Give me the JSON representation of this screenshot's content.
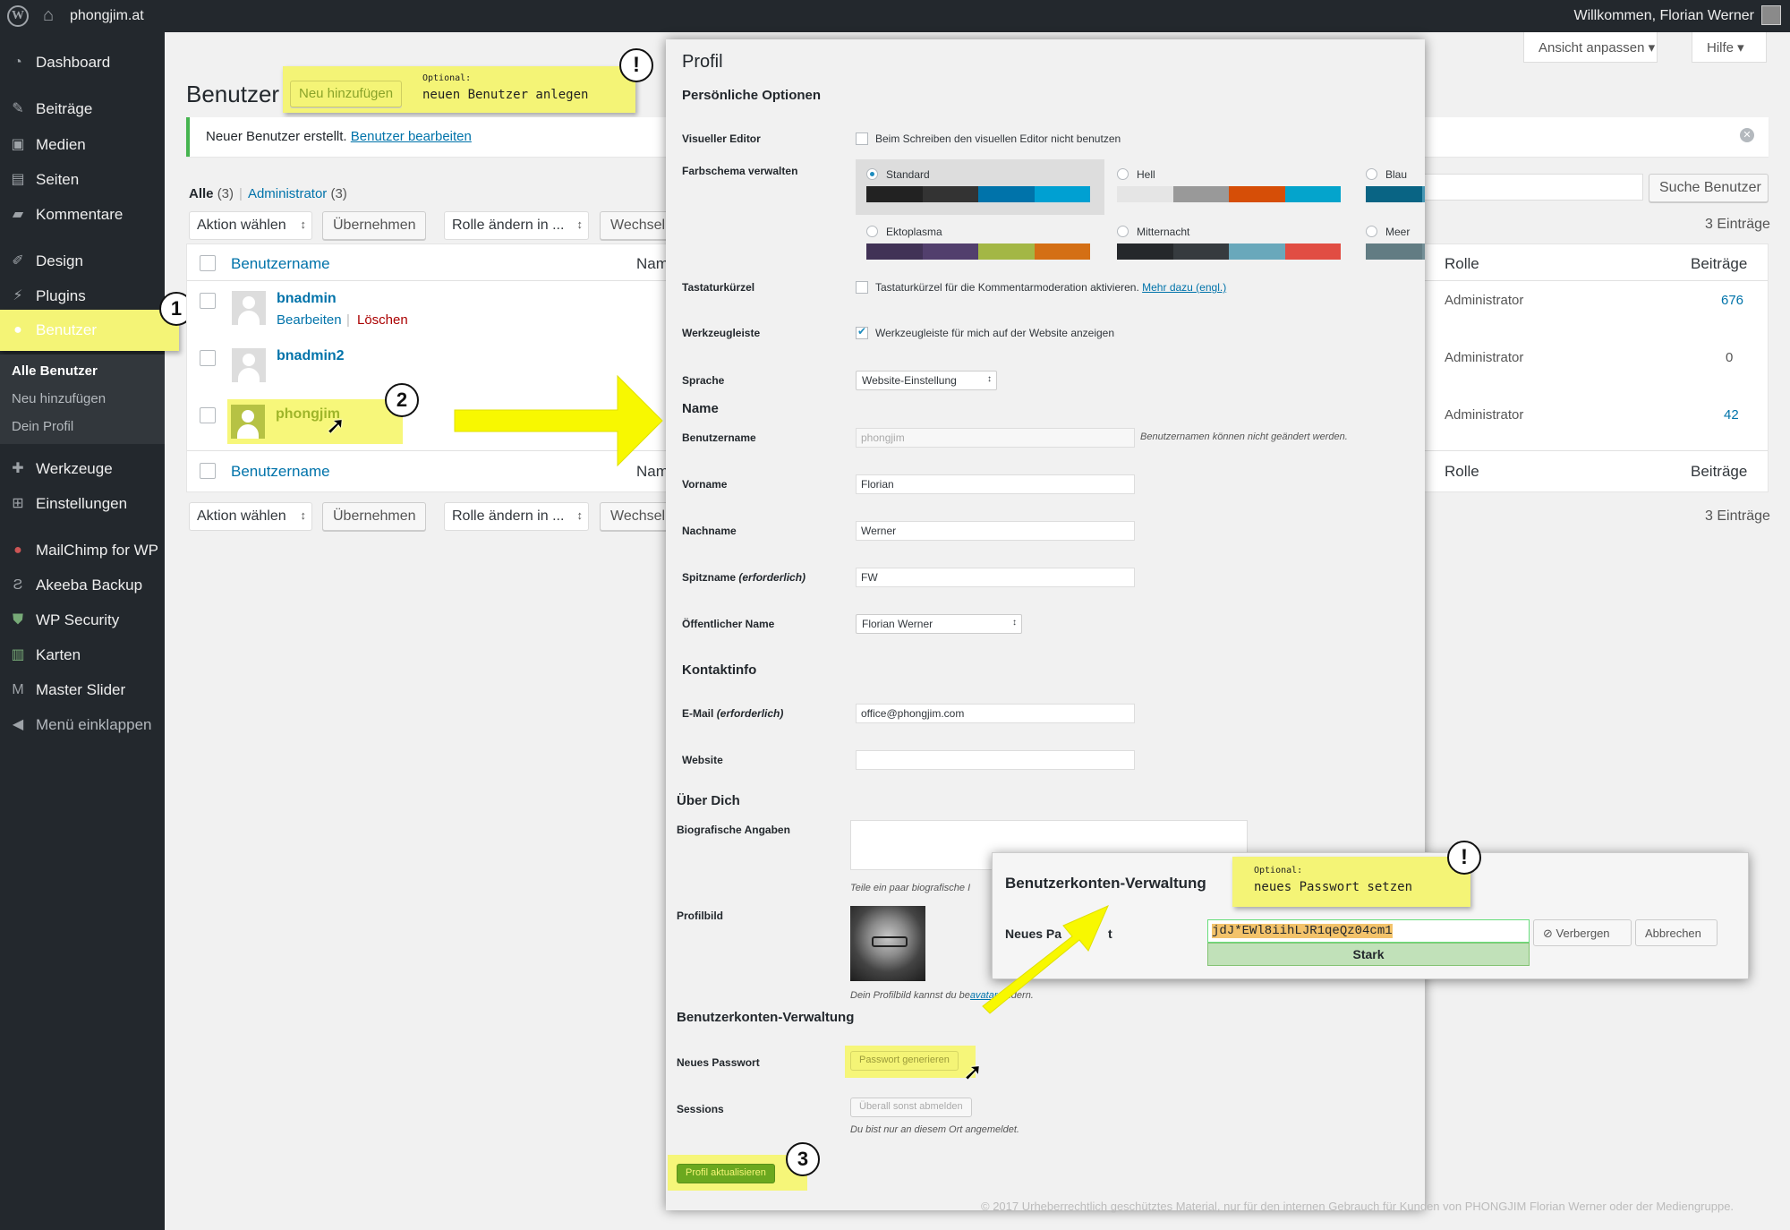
{
  "adminbar": {
    "site_name": "phongjim.at",
    "welcome": "Willkommen, Florian Werner"
  },
  "sidebar": {
    "items": [
      {
        "label": "Dashboard",
        "icon": "dashboard-icon"
      },
      {
        "label": "Beiträge",
        "icon": "pin-icon"
      },
      {
        "label": "Medien",
        "icon": "media-icon"
      },
      {
        "label": "Seiten",
        "icon": "pages-icon"
      },
      {
        "label": "Kommentare",
        "icon": "comment-icon"
      },
      {
        "label": "Design",
        "icon": "brush-icon"
      },
      {
        "label": "Plugins",
        "icon": "plug-icon"
      },
      {
        "label": "Benutzer",
        "icon": "user-icon"
      },
      {
        "label": "Werkzeuge",
        "icon": "wrench-icon"
      },
      {
        "label": "Einstellungen",
        "icon": "settings-icon"
      },
      {
        "label": "MailChimp for WP",
        "icon": "mailchimp-icon"
      },
      {
        "label": "Akeeba Backup",
        "icon": "akeeba-icon"
      },
      {
        "label": "WP Security",
        "icon": "shield-icon"
      },
      {
        "label": "Karten",
        "icon": "map-icon"
      },
      {
        "label": "Master Slider",
        "icon": "slider-icon"
      },
      {
        "label": "Menü einklappen",
        "icon": "collapse-icon"
      }
    ],
    "submenu": [
      "Alle Benutzer",
      "Neu hinzufügen",
      "Dein Profil"
    ]
  },
  "header": {
    "screen_options": "Ansicht anpassen",
    "help": "Hilfe",
    "title": "Benutzer",
    "add_new": "Neu hinzufügen"
  },
  "notice": {
    "text": "Neuer Benutzer erstellt.",
    "link": "Benutzer bearbeiten"
  },
  "filters": {
    "all_label": "Alle",
    "all_count": "(3)",
    "admin_label": "Administrator",
    "admin_count": "(3)"
  },
  "toolbar": {
    "bulk_action": "Aktion wählen",
    "apply": "Übernehmen",
    "change_role": "Rolle ändern in ...",
    "change": "Wechseln",
    "search_button": "Suche Benutzer",
    "entries": "3 Einträge"
  },
  "table": {
    "columns": {
      "username": "Benutzername",
      "name": "Name",
      "role": "Rolle",
      "posts": "Beiträge"
    },
    "rows": [
      {
        "username": "bnadmin",
        "role": "Administrator",
        "posts": "676",
        "actions": [
          "Bearbeiten",
          "Löschen"
        ]
      },
      {
        "username": "bnadmin2",
        "role": "Administrator",
        "posts": "0"
      },
      {
        "username": "phongjim",
        "role": "Administrator",
        "posts": "42"
      }
    ]
  },
  "annotations": {
    "optional_small": "Optional:",
    "new_user": "neuen Benutzer anlegen",
    "new_password": "neues Passwort setzen",
    "step1": "1",
    "step2": "2",
    "step3": "3",
    "exclaim": "!"
  },
  "profile": {
    "title": "Profil",
    "personal_options": "Persönliche Optionen",
    "visual_editor_label": "Visueller Editor",
    "visual_editor_text": "Beim Schreiben den visuellen Editor nicht benutzen",
    "color_scheme_label": "Farbschema verwalten",
    "schemes": [
      {
        "name": "Standard",
        "colors": [
          "#222222",
          "#333333",
          "#0073aa",
          "#00a0d2"
        ]
      },
      {
        "name": "Hell",
        "colors": [
          "#e5e5e5",
          "#999999",
          "#d64e07",
          "#04a4cc"
        ]
      },
      {
        "name": "Blau",
        "colors": [
          "#096484",
          "#4796b3",
          "#52accc",
          "#74b6ce"
        ]
      },
      {
        "name": "Ektoplasma",
        "colors": [
          "#413256",
          "#523f6d",
          "#a3b745",
          "#d46f15"
        ]
      },
      {
        "name": "Mitternacht",
        "colors": [
          "#25282b",
          "#363b3f",
          "#69a8bb",
          "#e14d43"
        ]
      },
      {
        "name": "Meer",
        "colors": [
          "#627c83",
          "#738e96",
          "#9ebaa0",
          "#aa9d88"
        ]
      }
    ],
    "shortcuts_label": "Tastaturkürzel",
    "shortcuts_text": "Tastaturkürzel für die Kommentarmoderation aktivieren.",
    "shortcuts_link": "Mehr dazu (engl.)",
    "toolbar_label": "Werkzeugleiste",
    "toolbar_text": "Werkzeugleiste für mich auf der Website anzeigen",
    "language_label": "Sprache",
    "language_value": "Website-Einstellung",
    "name_section": "Name",
    "username_label": "Benutzername",
    "username_value": "phongjim",
    "username_desc": "Benutzernamen können nicht geändert werden.",
    "firstname_label": "Vorname",
    "firstname_value": "Florian",
    "lastname_label": "Nachname",
    "lastname_value": "Werner",
    "nickname_label": "Spitzname",
    "required": "(erforderlich)",
    "nickname_value": "FW",
    "display_label": "Öffentlicher Name",
    "display_value": "Florian Werner",
    "contact_section": "Kontaktinfo",
    "email_label": "E-Mail",
    "email_value": "office@phongjim.com",
    "website_label": "Website",
    "about_section": "Über Dich",
    "bio_label": "Biografische Angaben",
    "bio_desc": "Teile ein paar biografische I",
    "picture_label": "Profilbild",
    "picture_desc_a": "Dein Profilbild kannst du be",
    "picture_desc_link": "avatar",
    "picture_desc_b": " ändern.",
    "account_section": "Benutzerkonten-Verwaltung",
    "new_password_label": "Neues Passwort",
    "generate_password": "Passwort generieren",
    "sessions_label": "Sessions",
    "logout_everywhere": "Überall sonst abmelden",
    "sessions_desc": "Du bist nur an diesem Ort angemeldet.",
    "update_button": "Profil aktualisieren"
  },
  "account_panel": {
    "title": "Benutzerkonten-Verwaltung",
    "label": "Neues Pa",
    "label_tail": "t",
    "password": "jdJ*EWl8iihLJR1qeQz04cm1",
    "strength": "Stark",
    "hide": "Verbergen",
    "cancel": "Abbrechen"
  },
  "footer": "© 2017 Urheberrechtlich geschütztes Material, nur für den internen Gebrauch für Kunden von PHONGJIM Florian Werner oder der Mediengruppe.",
  "colors": {
    "sidebar_bg": "#23282d",
    "accent": "#0073aa",
    "highlight": "#f4f476",
    "arrow": "#f8f800"
  }
}
